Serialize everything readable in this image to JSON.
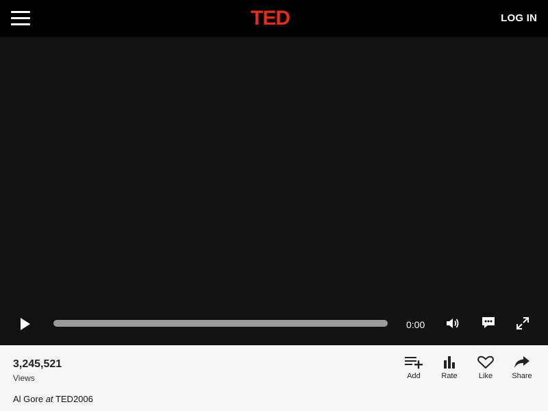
{
  "header": {
    "logo_text": "TED",
    "logo_color": "#e62b1e",
    "login_label": "LOG IN"
  },
  "player": {
    "current_time": "0:00",
    "progress": 0,
    "icons": [
      "play-icon",
      "volume-icon",
      "captions-icon",
      "fullscreen-icon"
    ]
  },
  "talk": {
    "views_count": "3,245,521",
    "views_label": "Views",
    "speaker": "Al Gore",
    "at_word": "at",
    "event": "TED2006"
  },
  "actions": [
    {
      "label": "Add",
      "icon": "add-to-list-icon"
    },
    {
      "label": "Rate",
      "icon": "rate-bars-icon"
    },
    {
      "label": "Like",
      "icon": "heart-icon"
    },
    {
      "label": "Share",
      "icon": "share-arrow-icon"
    }
  ]
}
